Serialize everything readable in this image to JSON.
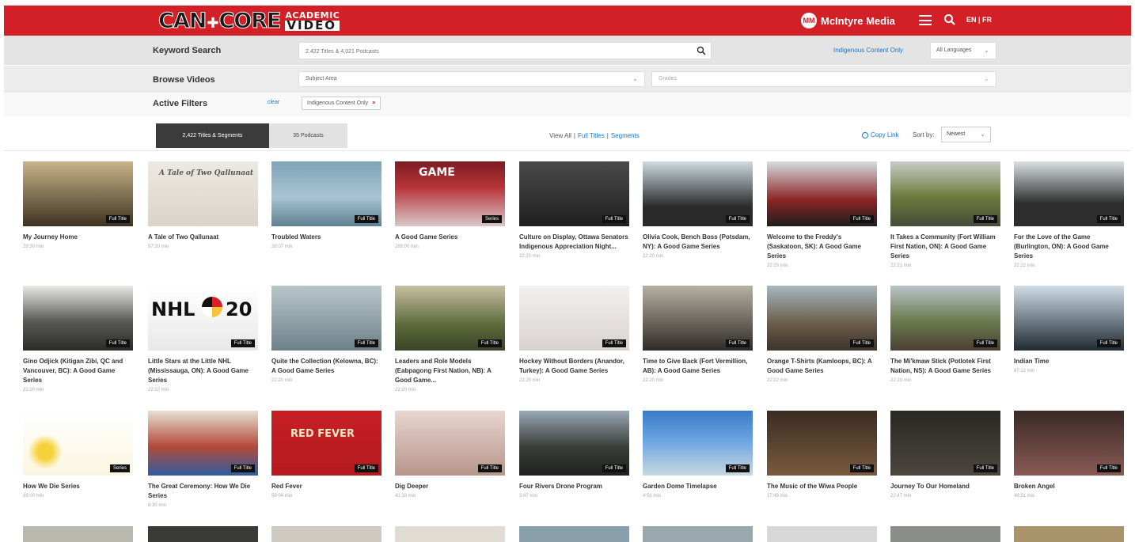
{
  "header": {
    "logo_main_left": "CAN",
    "logo_main_right": "CORE",
    "logo_sub_top": "ACADEMIC",
    "logo_sub_bottom": "VIDEO",
    "brand_badge": "MM",
    "brand_name": "McIntyre Media",
    "lang_toggle": "EN | FR",
    "bar_color": "#d32027"
  },
  "filters": {
    "keyword_label": "Keyword Search",
    "search_placeholder": "2,422 Titles & 4,021 Podcasts",
    "indigenous_link": "Indigenous Content Only",
    "language_select": "All Languages",
    "browse_label": "Browse Videos",
    "subject_select": "Subject Area",
    "grades_select": "Grades",
    "active_label": "Active Filters",
    "clear_label": "clear",
    "chip_label": "Indigenous Content Only"
  },
  "tabs": {
    "active": "2,422 Titles & Segments",
    "inactive": "35 Podcasts"
  },
  "view": {
    "prefix": "View All",
    "sep1": "|",
    "full": "Full Titles",
    "sep2": "|",
    "segments": "Segments"
  },
  "toolbar": {
    "copy_link": "Copy Link",
    "sort_label": "Sort by:",
    "sort_value": "Newest"
  },
  "videos": [
    {
      "title": "My Journey Home",
      "dur": "28:30 min",
      "badge": "Full Title"
    },
    {
      "title": "A Tale of Two Qallunaat",
      "dur": "97:20 min",
      "badge": ""
    },
    {
      "title": "Troubled Waters",
      "dur": "38:07 min",
      "badge": "Full Title"
    },
    {
      "title": "A Good Game Series",
      "dur": "288:00 min",
      "badge": "Series"
    },
    {
      "title": "Culture on Display, Ottawa Senators Indigenous Appreciation Night...",
      "dur": "22:20 min",
      "badge": "Full Title"
    },
    {
      "title": "Olivia Cook, Bench Boss (Potsdam, NY): A Good Game Series",
      "dur": "22:20 min",
      "badge": "Full Title"
    },
    {
      "title": "Welcome to the Freddy's (Saskatoon, SK): A Good Game Series",
      "dur": "22:20 min",
      "badge": "Full Title"
    },
    {
      "title": "It Takes a Community (Fort William First Nation, ON): A Good Game Series",
      "dur": "22:21 min",
      "badge": "Full Title"
    },
    {
      "title": "For the Love of the Game (Burlington, ON): A Good Game Series",
      "dur": "22:22 min",
      "badge": "Full Title"
    },
    {
      "title": "Gino Odjick (Kitigan Zibi, QC and Vancouver, BC): A Good Game Series",
      "dur": "22:20 min",
      "badge": "Full Title"
    },
    {
      "title": "Little Stars at the Little NHL (Mississauga, ON): A Good Game Series",
      "dur": "22:22 min",
      "badge": "Full Title"
    },
    {
      "title": "Quite the Collection (Kelowna, BC): A Good Game Series",
      "dur": "22:20 min",
      "badge": "Full Title"
    },
    {
      "title": "Leaders and Role Models (Eabpagong First Nation, NB): A Good Game...",
      "dur": "22:20 min",
      "badge": "Full Title"
    },
    {
      "title": "Hockey Without Borders (Anandor, Turkey): A Good Game Series",
      "dur": "22:20 min",
      "badge": "Full Title"
    },
    {
      "title": "Time to Give Back (Fort Vermillion, AB): A Good Game Series",
      "dur": "22:20 min",
      "badge": "Full Title"
    },
    {
      "title": "Orange T-Shirts (Kamloops, BC): A Good Game Series",
      "dur": "22:22 min",
      "badge": "Full Title"
    },
    {
      "title": "The Mi'kmaw Stick (Potlotek First Nation, NS): A Good Game Series",
      "dur": "22:20 min",
      "badge": "Full Title"
    },
    {
      "title": "Indian Time",
      "dur": "87:12 min",
      "badge": "Full Title"
    },
    {
      "title": "How We Die Series",
      "dur": "89:00 min",
      "badge": "Series"
    },
    {
      "title": "The Great Ceremony: How We Die Series",
      "dur": "8:30 min",
      "badge": "Full Title"
    },
    {
      "title": "Red Fever",
      "dur": "59:04 min",
      "badge": "Full Title"
    },
    {
      "title": "Dig Deeper",
      "dur": "41:18 min",
      "badge": "Full Title"
    },
    {
      "title": "Four Rivers Drone Program",
      "dur": "3:47 min",
      "badge": "Full Title"
    },
    {
      "title": "Garden Dome Timelapse",
      "dur": "4:56 min",
      "badge": "Full Title"
    },
    {
      "title": "The Music of the Wiwa People",
      "dur": "17:49 min",
      "badge": "Full Title"
    },
    {
      "title": "Journey To Our Homeland",
      "dur": "22:47 min",
      "badge": "Full Title"
    },
    {
      "title": "Broken Angel",
      "dur": "48:51 min",
      "badge": "Full Title"
    }
  ],
  "thumb_text": {
    "nhl": "NHL",
    "nhl_year": "20",
    "game": "GAME",
    "red_fever": "RED FEVER",
    "tale": "A Tale of Two Qallunaat"
  }
}
